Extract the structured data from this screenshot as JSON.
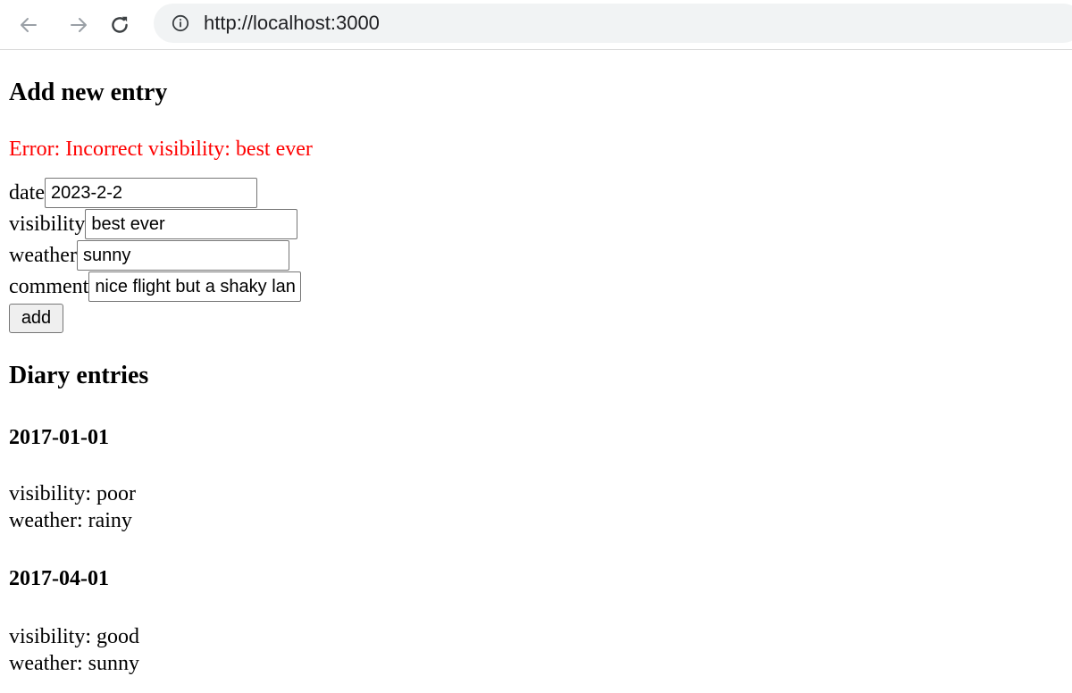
{
  "browser": {
    "url": "http://localhost:3000",
    "icons": {
      "back": "arrow-left-icon",
      "forward": "arrow-right-icon",
      "reload": "reload-icon",
      "site_info": "info-icon"
    }
  },
  "form": {
    "title": "Add new entry",
    "error": "Error: Incorrect visibility: best ever",
    "fields": {
      "date": {
        "label": "date",
        "value": "2023-2-2"
      },
      "visibility": {
        "label": "visibility",
        "value": "best ever"
      },
      "weather": {
        "label": "weather",
        "value": "sunny"
      },
      "comment": {
        "label": "comment",
        "value": "nice flight but a shaky landing"
      }
    },
    "submit_label": "add",
    "error_color": "#ff0000"
  },
  "diary": {
    "title": "Diary entries",
    "entries": [
      {
        "date": "2017-01-01",
        "visibility": "visibility: poor",
        "weather": "weather: rainy"
      },
      {
        "date": "2017-04-01",
        "visibility": "visibility: good",
        "weather": "weather: sunny"
      }
    ]
  }
}
